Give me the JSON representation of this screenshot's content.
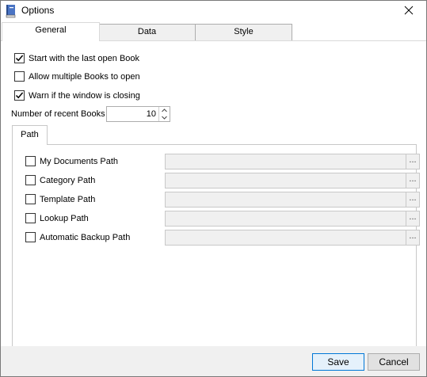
{
  "window": {
    "title": "Options"
  },
  "tabs": [
    {
      "label": "General",
      "active": true
    },
    {
      "label": "Data",
      "active": false
    },
    {
      "label": "Style",
      "active": false
    }
  ],
  "general": {
    "start_last_book": {
      "label": "Start with the last open Book",
      "checked": true
    },
    "allow_multiple": {
      "label": "Allow multiple Books to open",
      "checked": false
    },
    "warn_closing": {
      "label": "Warn if the window is closing",
      "checked": true
    },
    "recent_books": {
      "label": "Number of recent Books",
      "value": "10"
    }
  },
  "path_group": {
    "title": "Path",
    "rows": [
      {
        "label": "My Documents Path",
        "checked": false,
        "value": "",
        "browse": "..."
      },
      {
        "label": "Category Path",
        "checked": false,
        "value": "",
        "browse": "..."
      },
      {
        "label": "Template Path",
        "checked": false,
        "value": "",
        "browse": "..."
      },
      {
        "label": "Lookup Path",
        "checked": false,
        "value": "",
        "browse": "..."
      },
      {
        "label": "Automatic Backup Path",
        "checked": false,
        "value": "",
        "browse": "..."
      }
    ]
  },
  "footer": {
    "save_label": "Save",
    "cancel_label": "Cancel"
  },
  "colors": {
    "accent": "#0078d7",
    "footer_bg": "#f0f0f0",
    "field_bg": "#f0f0f0",
    "tab_inactive_bg": "#f0f0f0"
  },
  "icons": {
    "app": "book-icon",
    "close": "close-icon",
    "spin_up": "chevron-up-icon",
    "spin_down": "chevron-down-icon"
  }
}
